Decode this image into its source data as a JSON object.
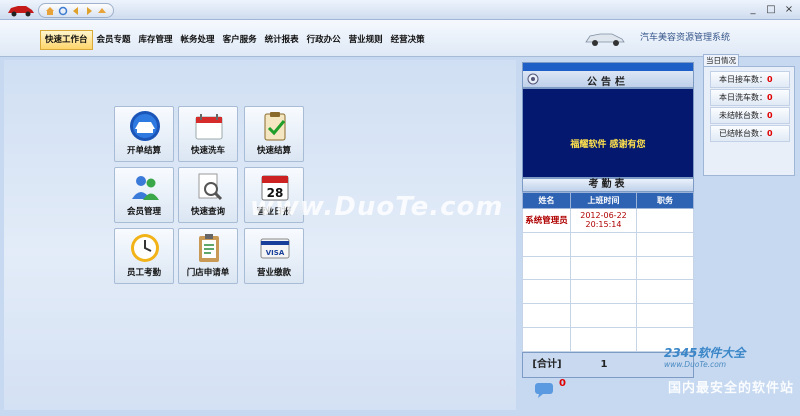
{
  "window": {
    "controls": [
      "_",
      "□",
      "×"
    ]
  },
  "quick_access": {
    "icons": [
      "home-icon",
      "refresh-icon",
      "back-icon",
      "forward-icon",
      "up-icon"
    ]
  },
  "menu": {
    "items": [
      "快速工作台",
      "会员专题",
      "库存管理",
      "帐务处理",
      "客户服务",
      "统计报表",
      "行政办公",
      "营业规则",
      "经营决策"
    ],
    "active_index": 0
  },
  "system_title": "汽车美容资源管理系统",
  "tiles": [
    {
      "label": "开单结算",
      "icon": "car-settlement-icon"
    },
    {
      "label": "快速洗车",
      "icon": "car-wash-icon"
    },
    {
      "label": "快速结算",
      "icon": "clipboard-check-icon"
    },
    {
      "label": "会员管理",
      "icon": "members-icon"
    },
    {
      "label": "快速查询",
      "icon": "search-document-icon"
    },
    {
      "label": "营业日报",
      "icon": "calendar-icon",
      "badge": "28"
    },
    {
      "label": "员工考勤",
      "icon": "clock-icon"
    },
    {
      "label": "门店申请单",
      "icon": "clipboard-icon"
    },
    {
      "label": "营业缴款",
      "icon": "credit-card-icon",
      "badge": "VISA"
    }
  ],
  "bulletin": {
    "title": "公告栏",
    "message": "福耀软件  感谢有您"
  },
  "attendance": {
    "title": "考勤表",
    "columns": [
      "姓名",
      "上班时间",
      "职务"
    ],
    "rows": [
      {
        "name": "系统管理员",
        "time": "2012-06-22 20:15:14",
        "role": ""
      }
    ],
    "total_label": "[合计]",
    "total_value": "1",
    "chat_count": "0"
  },
  "status": {
    "tab": "当日情况",
    "items": [
      {
        "label": "本日接车数：",
        "value": "0"
      },
      {
        "label": "本日洗车数：",
        "value": "0"
      },
      {
        "label": "未结帐台数：",
        "value": "0"
      },
      {
        "label": "已结帐台数：",
        "value": "0"
      }
    ]
  },
  "watermark": {
    "main": "www.DuoTe.com",
    "logo": "2345软件大全",
    "sub": "www.DuoTe.com",
    "cn": "国内最安全的软件站"
  },
  "colors": {
    "accent": "#2e62b3",
    "bulletin_bg": "#03186e",
    "highlight": "#e00000"
  }
}
